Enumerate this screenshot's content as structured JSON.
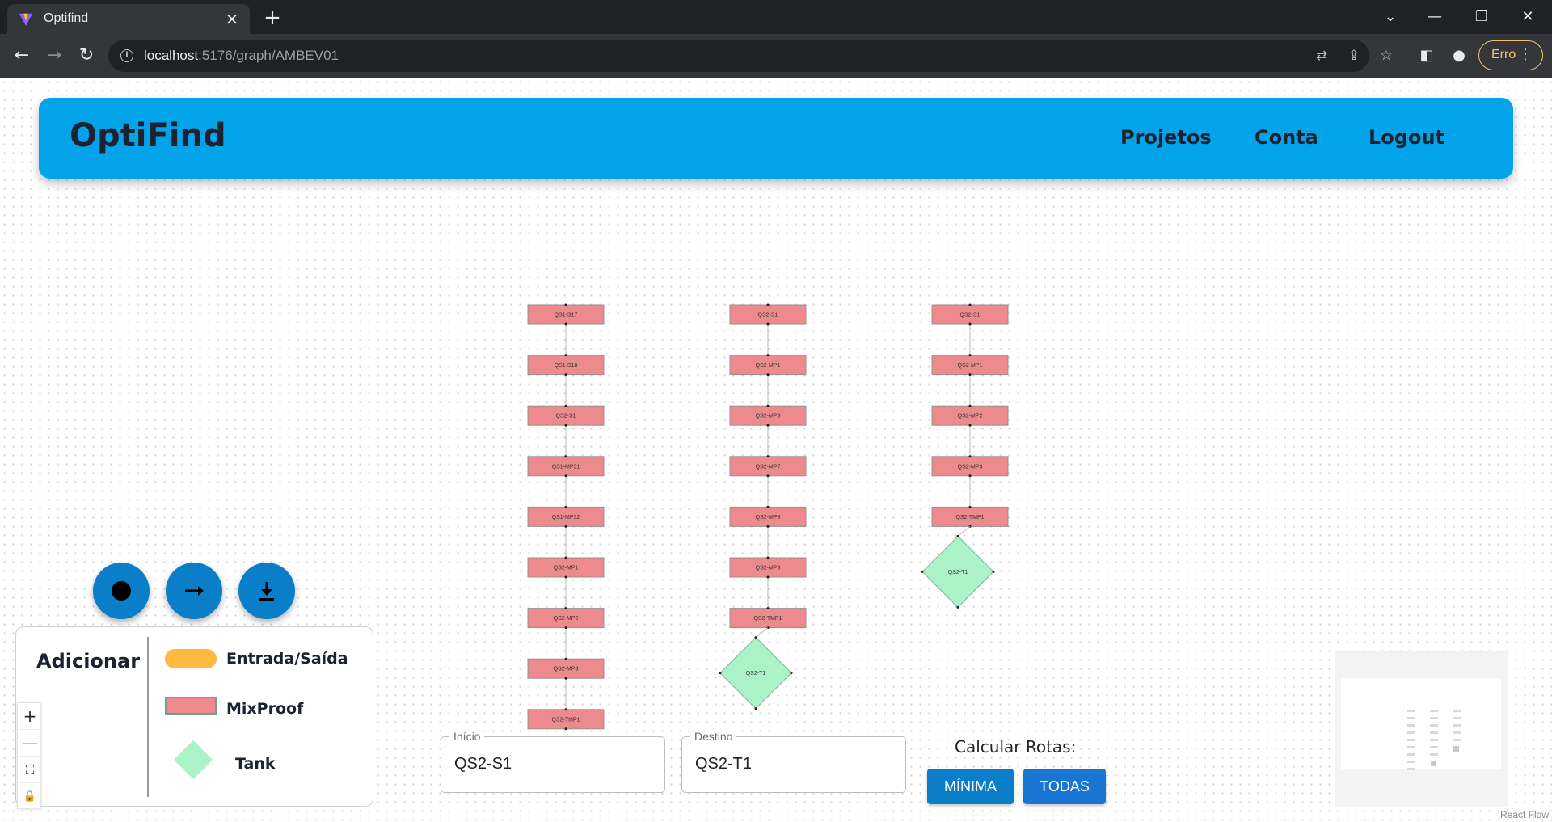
{
  "browser": {
    "tab_title": "Optifind",
    "url_host": "localhost",
    "url_path": ":5176/graph/AMBEV01",
    "profile_button": "Erro"
  },
  "header": {
    "brand": "OptiFind",
    "nav": [
      "Projetos",
      "Conta",
      "Logout"
    ]
  },
  "graph": {
    "columns": [
      [
        "QS1-S17",
        "QS1-S18",
        "QS2-S1",
        "QS1-MP31",
        "QS1-MP32",
        "QS2-MP1",
        "QS2-MP2",
        "QS2-MP3",
        "QS2-TMP1"
      ],
      [
        "QS2-S1",
        "QS2-MP1",
        "QS2-MP3",
        "QS2-MP7",
        "QS2-MP8",
        "QS2-MP9",
        "QS2-TMP1"
      ],
      [
        "QS2-S1",
        "QS2-MP1",
        "QS2-MP2",
        "QS2-MP3",
        "QS2-TMP1"
      ]
    ],
    "tanks": [
      "QS2-T1",
      "QS2-T1"
    ]
  },
  "actions": {
    "record_icon": "record-dot-icon",
    "edge_icon": "arrow-right-icon",
    "download_icon": "download-icon"
  },
  "legend": {
    "title": "Adicionar",
    "items": [
      "Entrada/Saída",
      "MixProof",
      "Tank"
    ],
    "colors": {
      "entrada": "#ffb840",
      "mixproof": "#ec8a8d",
      "tank": "#abf2c8"
    }
  },
  "zoom_controls": [
    "+",
    "—",
    "⛶",
    "🔒"
  ],
  "route_form": {
    "start_label": "Início",
    "start_value": "QS2-S1",
    "end_label": "Destino",
    "end_value": "QS2-T1",
    "calc_title": "Calcular Rotas:",
    "min_button": "MÍNIMA",
    "all_button": "TODAS"
  },
  "attribution": "React Flow",
  "colors": {
    "header_bg": "#03a3ea",
    "fab_bg": "#0a7ec9",
    "min_btn": "#0a7ec9",
    "all_btn": "#1976d2"
  }
}
